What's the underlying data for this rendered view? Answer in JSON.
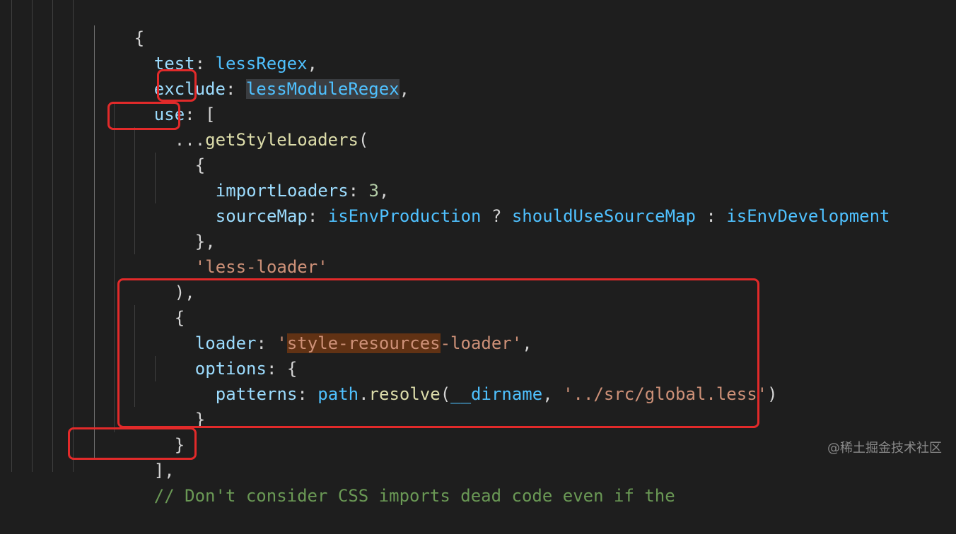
{
  "code": {
    "line1": {
      "brace": "{"
    },
    "line2": {
      "key": "test",
      "colon": ": ",
      "value": "lessRegex",
      "tail": ","
    },
    "line3": {
      "key": "exclude",
      "colon": ": ",
      "value": "lessModuleRegex",
      "tail": ","
    },
    "line4": {
      "key": "use",
      "colon": ": ",
      "bracket": "["
    },
    "line5": {
      "spread": "...",
      "func": "getStyleLoaders",
      "paren": "("
    },
    "line6": {
      "brace": "{"
    },
    "line7": {
      "key": "importLoaders",
      "colon": ": ",
      "number": "3",
      "tail": ","
    },
    "line8": {
      "key": "sourceMap",
      "colon": ": ",
      "v1": "isEnvProduction",
      "op1": " ? ",
      "v2": "shouldUseSourceMap",
      "op2": " : ",
      "v3": "isEnvDevelopment"
    },
    "line9": {
      "text": "},"
    },
    "line10": {
      "string": "'less-loader'"
    },
    "line11": {
      "text": "),"
    },
    "line12": {
      "brace": "{"
    },
    "line13": {
      "key": "loader",
      "colon": ": ",
      "quote_open": "'",
      "found": "style-resources",
      "rest": "-loader'",
      "tail": ","
    },
    "line14": {
      "key": "options",
      "colon": ": ",
      "brace": "{"
    },
    "line15": {
      "key": "patterns",
      "colon": ": ",
      "obj": "path",
      "dot": ".",
      "method": "resolve",
      "paren_open": "(",
      "arg1": "__dirname",
      "comma": ", ",
      "arg2": "'../src/global.less'",
      "paren_close": ")"
    },
    "line16": {
      "brace": "}"
    },
    "line17": {
      "brace": "}"
    },
    "line18": {
      "text": "],"
    },
    "line19": {
      "comment": "// Don't consider CSS imports dead code even if the"
    }
  },
  "watermark": "@稀土掘金技术社区",
  "colors": {
    "annotation_box": "#e22a2a",
    "background": "#1e1e1e"
  }
}
